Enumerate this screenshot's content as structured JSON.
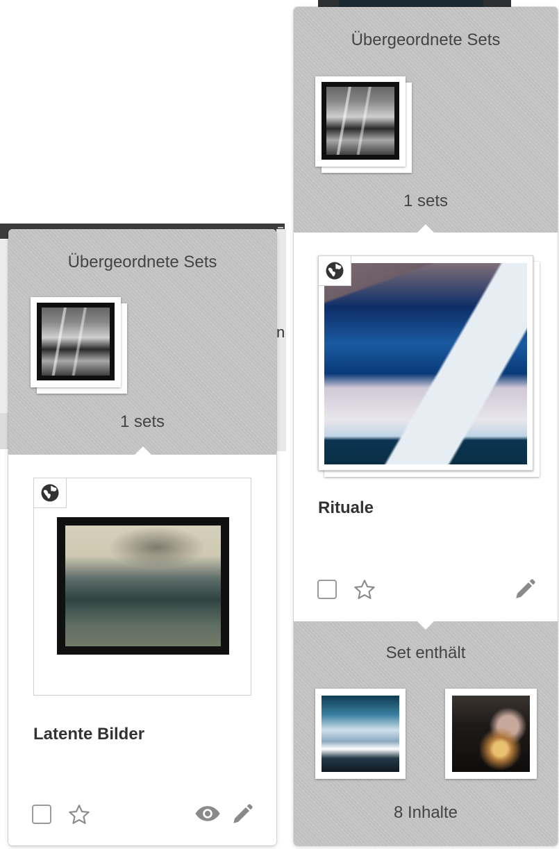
{
  "left_panel": {
    "parent_sets": {
      "title": "Übergeordnete Sets",
      "count": "1 sets"
    },
    "card": {
      "title": "Latente Bilder"
    }
  },
  "right_panel": {
    "parent_sets": {
      "title": "Übergeordnete Sets",
      "count": "1 sets"
    },
    "card": {
      "title": "Rituale"
    },
    "contains": {
      "title": "Set enthält",
      "count": "8 Inhalte"
    }
  },
  "colors": {
    "panel_gray": "#c5c5c5",
    "icon_gray": "#8a8a8a",
    "card_border": "#cfcfcf"
  },
  "icons": [
    "globe-icon",
    "checkbox-icon",
    "star-icon",
    "eye-icon",
    "pencil-icon"
  ]
}
